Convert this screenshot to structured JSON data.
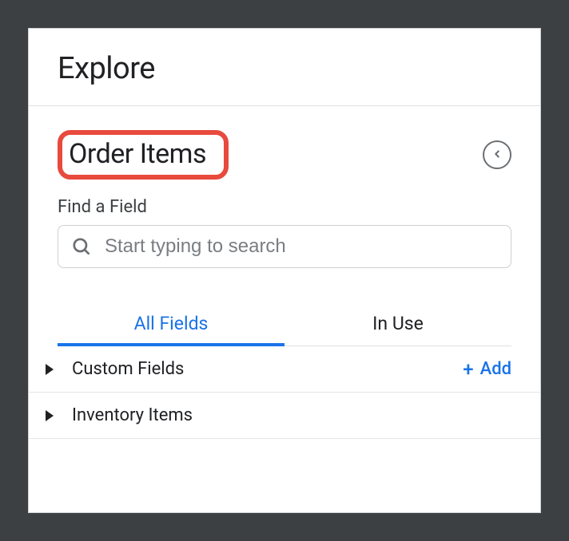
{
  "header": {
    "title": "Explore"
  },
  "explore": {
    "name": "Order Items"
  },
  "search": {
    "label": "Find a Field",
    "placeholder": "Start typing to search"
  },
  "tabs": {
    "all_fields": "All Fields",
    "in_use": "In Use"
  },
  "fields": [
    {
      "label": "Custom Fields",
      "add_label": "Add",
      "has_add": true
    },
    {
      "label": "Inventory Items",
      "has_add": false
    }
  ]
}
